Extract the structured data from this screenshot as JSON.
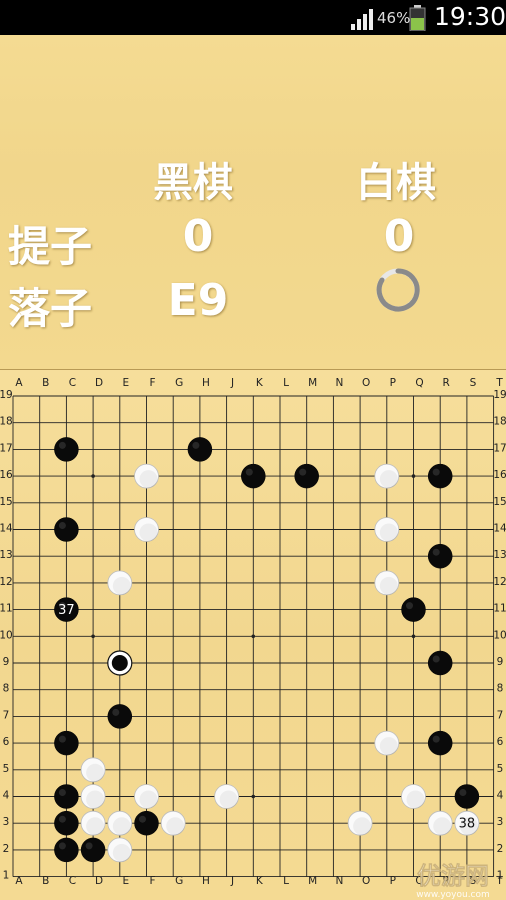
{
  "status": {
    "battery_percent": "46%",
    "time": "19:30"
  },
  "score": {
    "black_header": "黑棋",
    "white_header": "白棋",
    "captures_label": "提子",
    "move_label": "落子",
    "black_captures": "0",
    "white_captures": "0",
    "black_last_move": "E9"
  },
  "board": {
    "columns": [
      "A",
      "B",
      "C",
      "D",
      "E",
      "F",
      "G",
      "H",
      "J",
      "K",
      "L",
      "M",
      "N",
      "O",
      "P",
      "Q",
      "R",
      "S",
      "T"
    ],
    "rows": [
      "19",
      "18",
      "17",
      "16",
      "15",
      "14",
      "13",
      "12",
      "11",
      "10",
      "9",
      "8",
      "7",
      "6",
      "5",
      "4",
      "3",
      "2",
      "1"
    ],
    "black_stones": [
      "C17",
      "H17",
      "K16",
      "M16",
      "R16",
      "C14",
      "R13",
      "Q11",
      "R9",
      "E7",
      "C6",
      "R6",
      "S4",
      "C4",
      "C3",
      "F3",
      "C2",
      "D2",
      "C11"
    ],
    "white_stones": [
      "F16",
      "P16",
      "F14",
      "P14",
      "E12",
      "P12",
      "P6",
      "D5",
      "D4",
      "F4",
      "J4",
      "Q4",
      "D3",
      "E3",
      "G3",
      "O3",
      "R3",
      "E2",
      "S3"
    ],
    "last_move_marker": "E9",
    "move_numbers": [
      {
        "point": "C11",
        "label": "37",
        "color": "black"
      },
      {
        "point": "S3",
        "label": "38",
        "color": "white"
      }
    ]
  },
  "watermark": {
    "text": "优游网",
    "subtext": "www.yoyou.com"
  }
}
